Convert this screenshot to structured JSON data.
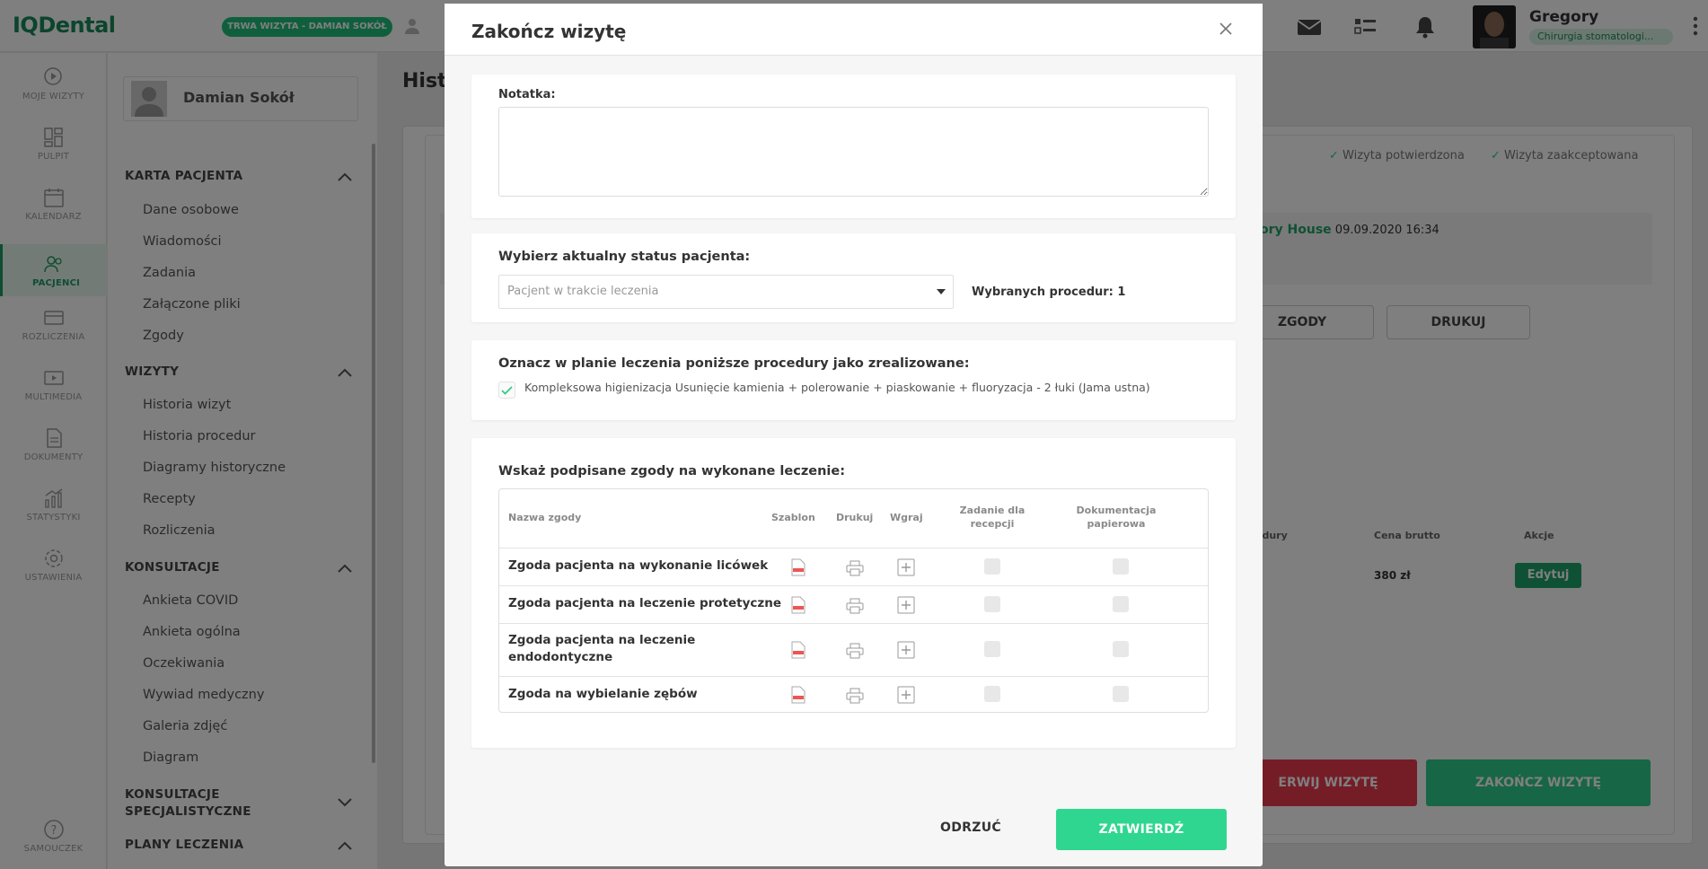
{
  "app": {
    "logo": "IQDental",
    "visit_badge": "TRWA WIZYTA - DAMIAN SOKÓŁ",
    "user": {
      "name": "Gregory",
      "role": "Chirurgia stomatologi..."
    }
  },
  "leftnav": [
    {
      "label": "MOJE WIZYTY",
      "icon": "play-circle-icon"
    },
    {
      "label": "PULPIT",
      "icon": "dashboard-icon"
    },
    {
      "label": "KALENDARZ",
      "icon": "calendar-icon"
    },
    {
      "label": "PACJENCI",
      "icon": "patients-icon",
      "active": true
    },
    {
      "label": "ROZLICZENIA",
      "icon": "card-icon"
    },
    {
      "label": "MULTIMEDIA",
      "icon": "media-icon"
    },
    {
      "label": "DOKUMENTY",
      "icon": "document-icon"
    },
    {
      "label": "STATYSTYKI",
      "icon": "stats-icon"
    },
    {
      "label": "USTAWIENIA",
      "icon": "gear-icon"
    },
    {
      "label": "SAMOUCZEK",
      "icon": "help-icon"
    }
  ],
  "sidebar": {
    "patient_name": "Damian Sokół",
    "sections": [
      {
        "title": "KARTA PACJENTA",
        "items": [
          "Dane osobowe",
          "Wiadomości",
          "Zadania",
          "Załączone pliki",
          "Zgody"
        ]
      },
      {
        "title": "WIZYTY",
        "items": [
          "Historia wizyt",
          "Historia procedur",
          "Diagramy historyczne",
          "Recepty",
          "Rozliczenia"
        ]
      },
      {
        "title": "KONSULTACJE",
        "items": [
          "Ankieta COVID",
          "Ankieta ogólna",
          "Oczekiwania",
          "Wywiad medyczny",
          "Galeria zdjęć",
          "Diagram"
        ]
      },
      {
        "title": "KONSULTACJE SPECJALISTYCZNE",
        "items": []
      },
      {
        "title": "PLANY LECZENIA",
        "items": []
      }
    ]
  },
  "background": {
    "title_partial": "Histo",
    "status_confirmed": "Wizyta potwierdzona",
    "status_accepted": "Wizyta zaakceptowana",
    "doctor_partial": "ory House",
    "datetime": "09.09.2020 16:34",
    "btn_zgody": "ZGODY",
    "btn_drukuj": "DRUKUJ",
    "col_procedury_partial": "edury",
    "col_cena": "Cena brutto",
    "col_akcje": "Akcje",
    "price": "380 zł",
    "btn_edit": "Edytuj",
    "btn_interrupt_partial": "ERWIJ WIZYTĘ",
    "btn_finish": "ZAKOŃCZ WIZYTĘ"
  },
  "modal": {
    "title": "Zakończ wizytę",
    "note_label": "Notatka:",
    "note_value": "",
    "status_label": "Wybierz aktualny status pacjenta:",
    "status_selected": "Pacjent w trakcie leczenia",
    "procedures_count": "Wybranych procedur: 1",
    "plan_label": "Oznacz w planie leczenia poniższe procedury jako zrealizowane:",
    "plan_procedure": "Kompleksowa higienizacja Usunięcie kamienia + polerowanie + piaskowanie + fluoryzacja - 2 łuki (Jama ustna)",
    "consents_label": "Wskaż podpisane zgody na wykonane leczenie:",
    "columns": {
      "name": "Nazwa zgody",
      "template": "Szablon",
      "print": "Drukuj",
      "upload": "Wgraj",
      "task": "Zadanie dla recepcji",
      "paper": "Dokumentacja papierowa"
    },
    "consents": [
      "Zgoda pacjenta na wykonanie licówek",
      "Zgoda pacjenta na leczenie protetyczne",
      "Zgoda pacjenta na leczenie endodontyczne",
      "Zgoda na wybielanie zębów"
    ],
    "btn_reject": "ODRZUĆ",
    "btn_confirm": "ZATWIERDŹ"
  }
}
